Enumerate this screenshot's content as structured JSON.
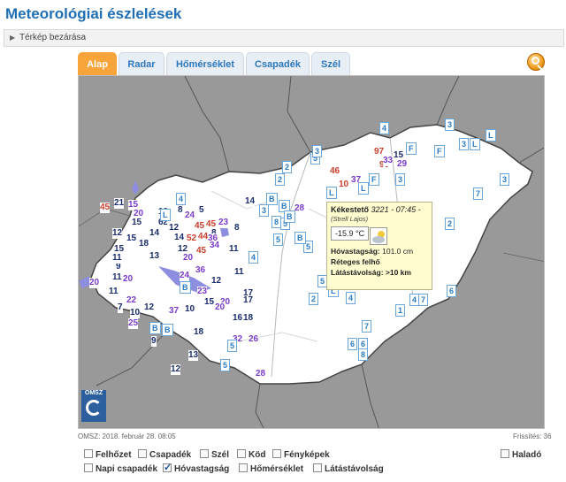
{
  "page": {
    "title": "Meteorológiai észlelések",
    "collapse_label": "Térkép bezárása"
  },
  "tabs": [
    {
      "label": "Alap",
      "active": true
    },
    {
      "label": "Radar",
      "active": false
    },
    {
      "label": "Hőmérséklet",
      "active": false
    },
    {
      "label": "Csapadék",
      "active": false
    },
    {
      "label": "Szél",
      "active": false
    }
  ],
  "colors": {
    "accent": "#f7a53a",
    "title": "#1f6fb5",
    "popup_bg": "#fffdd0"
  },
  "map": {
    "logo_text": "OMSZ",
    "station_values": [
      {
        "t": "45",
        "c": "red"
      },
      {
        "t": "21",
        "c": "navy"
      },
      {
        "t": "15",
        "c": "purple"
      },
      {
        "t": "20",
        "c": "purple"
      },
      {
        "t": "12",
        "c": "navy"
      },
      {
        "t": "10",
        "c": "navy"
      },
      {
        "t": "8",
        "c": "navy"
      },
      {
        "t": "5",
        "c": "navy"
      },
      {
        "t": "2",
        "c": "navy"
      },
      {
        "t": "24",
        "c": "purple"
      },
      {
        "t": "15",
        "c": "navy"
      },
      {
        "t": "7",
        "c": "navy"
      },
      {
        "t": "14",
        "c": "navy"
      },
      {
        "t": "6",
        "c": "navy"
      },
      {
        "t": "12",
        "c": "navy"
      },
      {
        "t": "15",
        "c": "navy"
      },
      {
        "t": "15",
        "c": "navy"
      },
      {
        "t": "9",
        "c": "navy"
      },
      {
        "t": "14",
        "c": "navy"
      },
      {
        "t": "45",
        "c": "red"
      },
      {
        "t": "45",
        "c": "red"
      },
      {
        "t": "23",
        "c": "purple"
      },
      {
        "t": "8",
        "c": "navy"
      },
      {
        "t": "8",
        "c": "navy"
      },
      {
        "t": "11",
        "c": "navy"
      },
      {
        "t": "18",
        "c": "navy"
      },
      {
        "t": "12",
        "c": "navy"
      },
      {
        "t": "52",
        "c": "red"
      },
      {
        "t": "44",
        "c": "red"
      },
      {
        "t": "36",
        "c": "purple"
      },
      {
        "t": "11",
        "c": "navy"
      },
      {
        "t": "13",
        "c": "navy"
      },
      {
        "t": "20",
        "c": "purple"
      },
      {
        "t": "45",
        "c": "red"
      },
      {
        "t": "34",
        "c": "purple"
      },
      {
        "t": "11",
        "c": "navy"
      },
      {
        "t": "20",
        "c": "purple"
      },
      {
        "t": "11",
        "c": "navy"
      },
      {
        "t": "20",
        "c": "purple"
      },
      {
        "t": "24",
        "c": "purple"
      },
      {
        "t": "36",
        "c": "purple"
      },
      {
        "t": "11",
        "c": "navy"
      },
      {
        "t": "22",
        "c": "purple"
      },
      {
        "t": "23",
        "c": "purple"
      },
      {
        "t": "20",
        "c": "purple"
      },
      {
        "t": "12",
        "c": "navy"
      },
      {
        "t": "7",
        "c": "navy"
      },
      {
        "t": "10",
        "c": "navy"
      },
      {
        "t": "37",
        "c": "purple"
      },
      {
        "t": "10",
        "c": "navy"
      },
      {
        "t": "15",
        "c": "navy"
      },
      {
        "t": "20",
        "c": "purple"
      },
      {
        "t": "25",
        "c": "purple"
      },
      {
        "t": "9",
        "c": "navy"
      },
      {
        "t": "18",
        "c": "navy"
      },
      {
        "t": "16",
        "c": "navy"
      },
      {
        "t": "18",
        "c": "navy"
      },
      {
        "t": "32",
        "c": "purple"
      },
      {
        "t": "26",
        "c": "purple"
      },
      {
        "t": "13",
        "c": "navy"
      },
      {
        "t": "12",
        "c": "navy"
      },
      {
        "t": "28",
        "c": "purple"
      },
      {
        "t": "17",
        "c": "navy"
      },
      {
        "t": "14",
        "c": "navy"
      },
      {
        "t": "28",
        "c": "purple"
      },
      {
        "t": "46",
        "c": "red"
      },
      {
        "t": "10",
        "c": "red"
      },
      {
        "t": "37",
        "c": "purple"
      },
      {
        "t": "97",
        "c": "red"
      },
      {
        "t": "90",
        "c": "red"
      },
      {
        "t": "15",
        "c": "navy"
      },
      {
        "t": "33",
        "c": "purple"
      },
      {
        "t": "29",
        "c": "purple"
      },
      {
        "t": "20",
        "c": "purple"
      },
      {
        "t": "17",
        "c": "navy"
      },
      {
        "t": "12",
        "c": "navy"
      }
    ],
    "boxed_labels": [
      {
        "t": "3"
      },
      {
        "t": "3"
      },
      {
        "t": "3"
      },
      {
        "t": "F"
      },
      {
        "t": "F"
      },
      {
        "t": "L"
      },
      {
        "t": "L"
      },
      {
        "t": "L"
      },
      {
        "t": "7"
      },
      {
        "t": "3"
      },
      {
        "t": "4"
      },
      {
        "t": "2"
      },
      {
        "t": "5"
      },
      {
        "t": "F"
      },
      {
        "t": "L"
      },
      {
        "t": "B"
      },
      {
        "t": "2"
      },
      {
        "t": "3"
      },
      {
        "t": "5"
      },
      {
        "t": "B"
      },
      {
        "t": "8"
      },
      {
        "t": "B"
      },
      {
        "t": "5"
      },
      {
        "t": "5"
      },
      {
        "t": "2"
      },
      {
        "t": "4"
      },
      {
        "t": "4"
      },
      {
        "t": "B"
      },
      {
        "t": "B"
      },
      {
        "t": "3"
      },
      {
        "t": "2"
      },
      {
        "t": "5"
      },
      {
        "t": "5"
      },
      {
        "t": "7"
      },
      {
        "t": "4"
      },
      {
        "t": "1"
      },
      {
        "t": "7"
      },
      {
        "t": "6"
      },
      {
        "t": "6"
      },
      {
        "t": "8"
      },
      {
        "t": "5"
      },
      {
        "t": "L"
      },
      {
        "t": "B"
      },
      {
        "t": "4"
      },
      {
        "t": "2"
      },
      {
        "t": "L"
      },
      {
        "t": "B"
      },
      {
        "t": "6"
      }
    ],
    "popup": {
      "station": "Kékestető",
      "id_time": "3221 - 07:45 -",
      "observer": "(Strell Lajos)",
      "temp": "-15.9",
      "temp_unit": "°C",
      "snow_label": "Hóvastagság:",
      "snow_value": "101.0 cm",
      "cloud_text": "Réteges felhő",
      "vis_label": "Látástávolság:",
      "vis_value": ">10 km"
    }
  },
  "footer": {
    "timestamp": "OMSZ: 2018. február 28. 08:05",
    "refresh": "Frissítés: 36"
  },
  "options": [
    {
      "label": "Felhőzet",
      "checked": false
    },
    {
      "label": "Csapadék",
      "checked": false
    },
    {
      "label": "Szél",
      "checked": false
    },
    {
      "label": "Köd",
      "checked": false
    },
    {
      "label": "Fényképek",
      "checked": false
    },
    {
      "label": "Haladó",
      "checked": false
    },
    {
      "label": "Napi csapadék",
      "checked": false
    },
    {
      "label": "Hóvastagság",
      "checked": true
    },
    {
      "label": "Hőmérséklet",
      "checked": false
    },
    {
      "label": "Látástávolság",
      "checked": false
    }
  ]
}
